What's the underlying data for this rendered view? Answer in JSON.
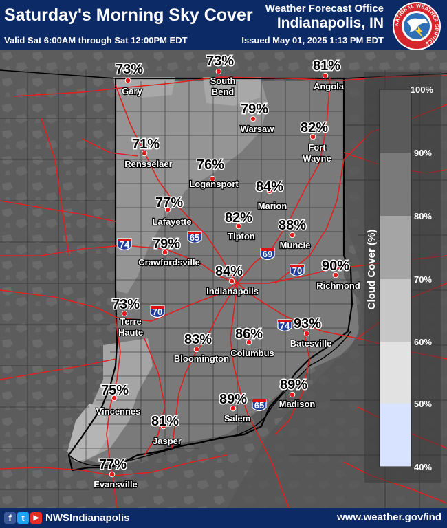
{
  "header": {
    "title": "Saturday's Morning Sky Cover",
    "office_line1": "Weather Forecast Office",
    "office_line2": "Indianapolis, IN",
    "valid": "Valid Sat 6:00AM through Sat 12:00PM EDT",
    "issued": "Issued May 01, 2025 1:13 PM EDT",
    "logo_text": "NATIONAL WEATHER SERVICE"
  },
  "legend": {
    "title": "Cloud Cover (%)",
    "ticks": [
      "100%",
      "90%",
      "80%",
      "70%",
      "60%",
      "50%",
      "40%"
    ],
    "colors": {
      "c90_100": "#5a5a5a",
      "c80_90": "#7a7a7a",
      "c70_80": "#a5a5a5",
      "c60_70": "#c7c7c7",
      "c50_60": "#e2e2e2",
      "c40_50": "#d8e4ff"
    }
  },
  "highways": [
    "74",
    "65",
    "69",
    "70",
    "70",
    "74",
    "65"
  ],
  "cities": [
    {
      "name": [
        "Gary"
      ],
      "value": "73%"
    },
    {
      "name": [
        "South",
        "Bend"
      ],
      "value": "73%"
    },
    {
      "name": [
        "Angola"
      ],
      "value": "81%"
    },
    {
      "name": [
        "Warsaw"
      ],
      "value": "79%"
    },
    {
      "name": [
        "Fort",
        "Wayne"
      ],
      "value": "82%"
    },
    {
      "name": [
        "Rensselaer"
      ],
      "value": "71%"
    },
    {
      "name": [
        "Logansport"
      ],
      "value": "76%"
    },
    {
      "name": [
        "Marion"
      ],
      "value": "84%"
    },
    {
      "name": [
        "Lafayette"
      ],
      "value": "77%"
    },
    {
      "name": [
        "Tipton"
      ],
      "value": "82%"
    },
    {
      "name": [
        "Muncie"
      ],
      "value": "88%"
    },
    {
      "name": [
        "Crawfordsville"
      ],
      "value": "79%"
    },
    {
      "name": [
        "Indianapolis"
      ],
      "value": "84%"
    },
    {
      "name": [
        "Richmond"
      ],
      "value": "90%"
    },
    {
      "name": [
        "Terre",
        "Haute"
      ],
      "value": "73%"
    },
    {
      "name": [
        "Bloomington"
      ],
      "value": "83%"
    },
    {
      "name": [
        "Columbus"
      ],
      "value": "86%"
    },
    {
      "name": [
        "Batesville"
      ],
      "value": "93%"
    },
    {
      "name": [
        "Vincennes"
      ],
      "value": "75%"
    },
    {
      "name": [
        "Jasper"
      ],
      "value": "81%"
    },
    {
      "name": [
        "Salem"
      ],
      "value": "89%"
    },
    {
      "name": [
        "Madison"
      ],
      "value": "89%"
    },
    {
      "name": [
        "Evansville"
      ],
      "value": "77%"
    }
  ],
  "footer": {
    "facebook_icon": "f",
    "twitter_icon": "t",
    "youtube_icon": "▶",
    "handle": "NWSIndianapolis",
    "website": "www.weather.gov/ind"
  }
}
